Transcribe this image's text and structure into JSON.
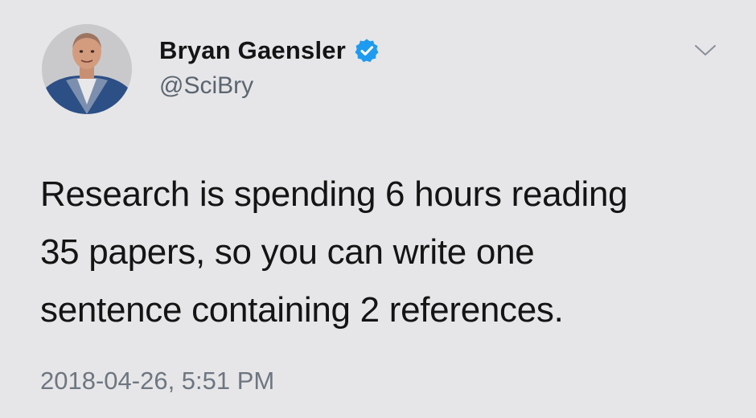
{
  "tweet": {
    "author": {
      "display_name": "Bryan Gaensler",
      "handle": "@SciBry",
      "verified": true
    },
    "body_lines": [
      "Research is spending 6 hours reading",
      "35 papers, so you can write one",
      "sentence containing 2 references."
    ],
    "timestamp": "2018-04-26, 5:51 PM"
  },
  "icons": {
    "verified": "verified-badge-icon",
    "menu": "chevron-down-icon"
  },
  "colors": {
    "background": "#e6e6e8",
    "verified_blue": "#1d9bf0",
    "handle_gray": "#5b6570"
  }
}
